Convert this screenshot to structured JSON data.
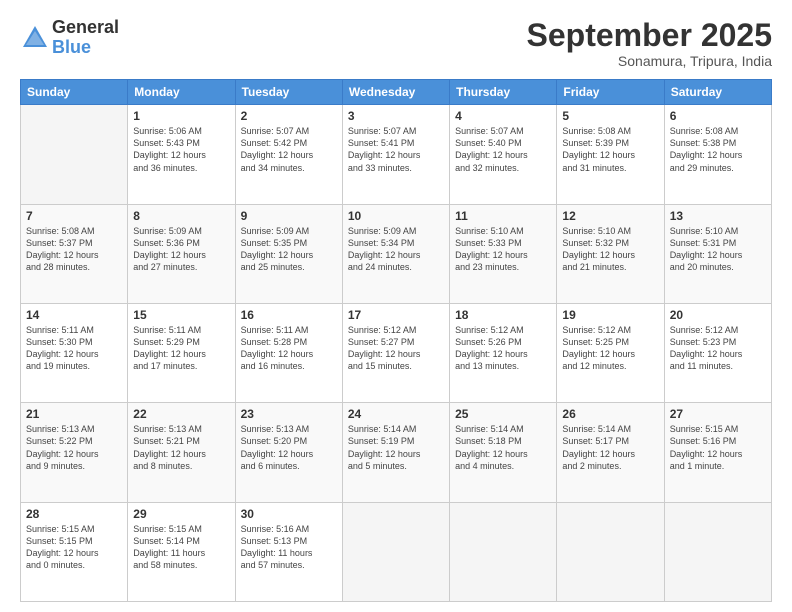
{
  "logo": {
    "general": "General",
    "blue": "Blue"
  },
  "title": "September 2025",
  "location": "Sonamura, Tripura, India",
  "weekdays": [
    "Sunday",
    "Monday",
    "Tuesday",
    "Wednesday",
    "Thursday",
    "Friday",
    "Saturday"
  ],
  "weeks": [
    [
      {
        "num": "",
        "info": ""
      },
      {
        "num": "1",
        "info": "Sunrise: 5:06 AM\nSunset: 5:43 PM\nDaylight: 12 hours\nand 36 minutes."
      },
      {
        "num": "2",
        "info": "Sunrise: 5:07 AM\nSunset: 5:42 PM\nDaylight: 12 hours\nand 34 minutes."
      },
      {
        "num": "3",
        "info": "Sunrise: 5:07 AM\nSunset: 5:41 PM\nDaylight: 12 hours\nand 33 minutes."
      },
      {
        "num": "4",
        "info": "Sunrise: 5:07 AM\nSunset: 5:40 PM\nDaylight: 12 hours\nand 32 minutes."
      },
      {
        "num": "5",
        "info": "Sunrise: 5:08 AM\nSunset: 5:39 PM\nDaylight: 12 hours\nand 31 minutes."
      },
      {
        "num": "6",
        "info": "Sunrise: 5:08 AM\nSunset: 5:38 PM\nDaylight: 12 hours\nand 29 minutes."
      }
    ],
    [
      {
        "num": "7",
        "info": "Sunrise: 5:08 AM\nSunset: 5:37 PM\nDaylight: 12 hours\nand 28 minutes."
      },
      {
        "num": "8",
        "info": "Sunrise: 5:09 AM\nSunset: 5:36 PM\nDaylight: 12 hours\nand 27 minutes."
      },
      {
        "num": "9",
        "info": "Sunrise: 5:09 AM\nSunset: 5:35 PM\nDaylight: 12 hours\nand 25 minutes."
      },
      {
        "num": "10",
        "info": "Sunrise: 5:09 AM\nSunset: 5:34 PM\nDaylight: 12 hours\nand 24 minutes."
      },
      {
        "num": "11",
        "info": "Sunrise: 5:10 AM\nSunset: 5:33 PM\nDaylight: 12 hours\nand 23 minutes."
      },
      {
        "num": "12",
        "info": "Sunrise: 5:10 AM\nSunset: 5:32 PM\nDaylight: 12 hours\nand 21 minutes."
      },
      {
        "num": "13",
        "info": "Sunrise: 5:10 AM\nSunset: 5:31 PM\nDaylight: 12 hours\nand 20 minutes."
      }
    ],
    [
      {
        "num": "14",
        "info": "Sunrise: 5:11 AM\nSunset: 5:30 PM\nDaylight: 12 hours\nand 19 minutes."
      },
      {
        "num": "15",
        "info": "Sunrise: 5:11 AM\nSunset: 5:29 PM\nDaylight: 12 hours\nand 17 minutes."
      },
      {
        "num": "16",
        "info": "Sunrise: 5:11 AM\nSunset: 5:28 PM\nDaylight: 12 hours\nand 16 minutes."
      },
      {
        "num": "17",
        "info": "Sunrise: 5:12 AM\nSunset: 5:27 PM\nDaylight: 12 hours\nand 15 minutes."
      },
      {
        "num": "18",
        "info": "Sunrise: 5:12 AM\nSunset: 5:26 PM\nDaylight: 12 hours\nand 13 minutes."
      },
      {
        "num": "19",
        "info": "Sunrise: 5:12 AM\nSunset: 5:25 PM\nDaylight: 12 hours\nand 12 minutes."
      },
      {
        "num": "20",
        "info": "Sunrise: 5:12 AM\nSunset: 5:23 PM\nDaylight: 12 hours\nand 11 minutes."
      }
    ],
    [
      {
        "num": "21",
        "info": "Sunrise: 5:13 AM\nSunset: 5:22 PM\nDaylight: 12 hours\nand 9 minutes."
      },
      {
        "num": "22",
        "info": "Sunrise: 5:13 AM\nSunset: 5:21 PM\nDaylight: 12 hours\nand 8 minutes."
      },
      {
        "num": "23",
        "info": "Sunrise: 5:13 AM\nSunset: 5:20 PM\nDaylight: 12 hours\nand 6 minutes."
      },
      {
        "num": "24",
        "info": "Sunrise: 5:14 AM\nSunset: 5:19 PM\nDaylight: 12 hours\nand 5 minutes."
      },
      {
        "num": "25",
        "info": "Sunrise: 5:14 AM\nSunset: 5:18 PM\nDaylight: 12 hours\nand 4 minutes."
      },
      {
        "num": "26",
        "info": "Sunrise: 5:14 AM\nSunset: 5:17 PM\nDaylight: 12 hours\nand 2 minutes."
      },
      {
        "num": "27",
        "info": "Sunrise: 5:15 AM\nSunset: 5:16 PM\nDaylight: 12 hours\nand 1 minute."
      }
    ],
    [
      {
        "num": "28",
        "info": "Sunrise: 5:15 AM\nSunset: 5:15 PM\nDaylight: 12 hours\nand 0 minutes."
      },
      {
        "num": "29",
        "info": "Sunrise: 5:15 AM\nSunset: 5:14 PM\nDaylight: 11 hours\nand 58 minutes."
      },
      {
        "num": "30",
        "info": "Sunrise: 5:16 AM\nSunset: 5:13 PM\nDaylight: 11 hours\nand 57 minutes."
      },
      {
        "num": "",
        "info": ""
      },
      {
        "num": "",
        "info": ""
      },
      {
        "num": "",
        "info": ""
      },
      {
        "num": "",
        "info": ""
      }
    ]
  ]
}
